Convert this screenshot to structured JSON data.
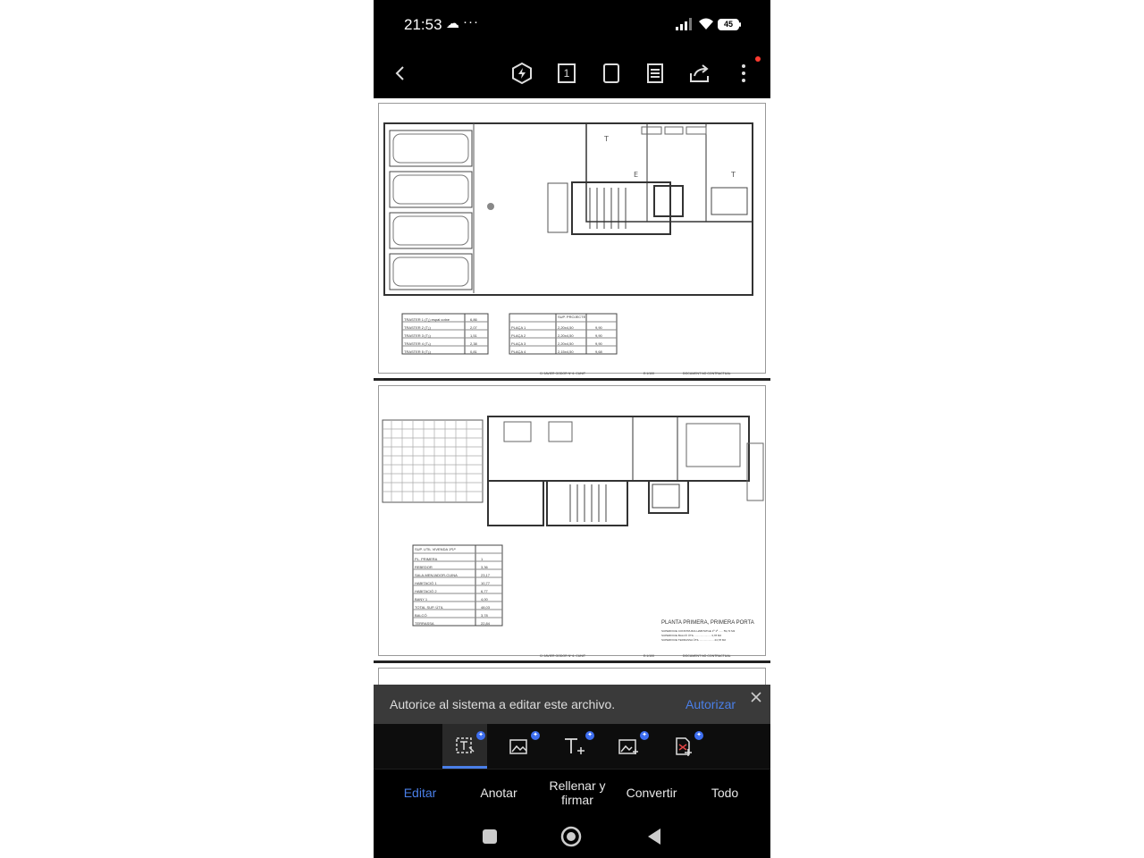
{
  "status_bar": {
    "time": "21:53",
    "cloud_icon": "cloud-icon",
    "more": "···",
    "battery": "45"
  },
  "toolbar": {
    "back_icon": "chevron-left-icon",
    "tools": [
      "lightning-hex-icon",
      "single-page-icon",
      "page-frame-icon",
      "document-list-icon",
      "share-icon",
      "more-vertical-icon"
    ],
    "page_number": "1"
  },
  "document": {
    "page1": {
      "table_left": {
        "rows": [
          [
            "TRASTER 1 (T₁) espai cotxe",
            "6,86"
          ],
          [
            "TRASTER 2 (T₂)",
            "2,07"
          ],
          [
            "TRASTER 3 (T₃)",
            "1,51"
          ],
          [
            "TRASTER 4 (T₄)",
            "2,38"
          ],
          [
            "TRASTER 5 (T₅)",
            "0,81"
          ]
        ]
      },
      "table_right": {
        "header": "SUP. PROJECTE",
        "rows": [
          [
            "PLAÇA 1",
            "2,20x4,50",
            "9,90"
          ],
          [
            "PLAÇA 2",
            "2,20x4,50",
            "9,90"
          ],
          [
            "PLAÇA 3",
            "2,20x4,50",
            "9,90"
          ],
          [
            "PLAÇA 4",
            "2,15x4,50",
            "9,68"
          ]
        ]
      },
      "footer": [
        "C/ JAVIER GODOR Nº 6. CUNIT",
        "E:1/100",
        "DOCUMENT NO CONTRACTUAL"
      ]
    },
    "page2": {
      "table": {
        "title": "SUP. UTIL VIVENDA 1ª1ª",
        "rows": [
          [
            "PL. PRIMERA",
            "1"
          ],
          [
            "REBEDOR",
            "3,36"
          ],
          [
            "SALA-MENJADOR-CUINA",
            "23,17"
          ],
          [
            "HABITACIÓ 1",
            "10,77"
          ],
          [
            "HABITACIÓ 2",
            "6,77"
          ],
          [
            "BANY 1",
            "4,00"
          ],
          [
            "TOTAL SUP. ÚTIL",
            "48,03"
          ],
          [
            "BALCÓ",
            "3,78"
          ],
          [
            "TERRASSA",
            "22,84"
          ]
        ]
      },
      "plan_title": "PLANTA PRIMERA, PRIMERA PORTA",
      "plan_details": [
        "SUPERFICIE CONSTRUIDA HABITATGE 1ª 1ª ...... 59,72 M2",
        "SUPERFICIE BALCÓ ÚTIL ...................... 3,78 M2",
        "SUPERFICIE TERRASSA ÚTIL ................... 24,78 M2"
      ],
      "footer": [
        "C/ JAVIER GODOR Nº 6. CUNIT",
        "E:1/100",
        "DOCUMENT NO CONTRACTUAL"
      ]
    }
  },
  "banner": {
    "message": "Autorice al sistema a editar este archivo.",
    "action": "Autorizar"
  },
  "edit_tools": [
    "edit-text-icon",
    "edit-image-icon",
    "add-text-icon",
    "add-image-icon",
    "document-convert-icon"
  ],
  "tabs": [
    "Editar",
    "Anotar",
    "Rellenar y\nfirmar",
    "Convertir",
    "Todo"
  ],
  "colors": {
    "accent": "#4a7fe8",
    "badge": "#3d6ef0",
    "banner_bg": "#3a3a3a",
    "background": "#000000"
  }
}
